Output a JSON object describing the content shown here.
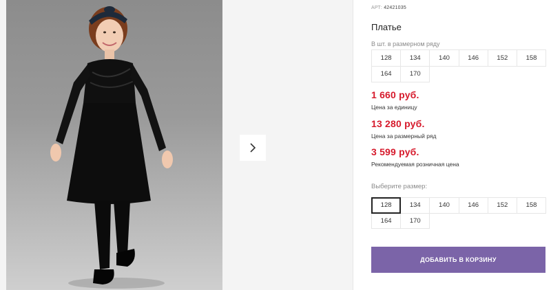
{
  "gallery": {
    "photo_alt": "Платье",
    "next_icon": "chevron-right-icon"
  },
  "product": {
    "art_label": "АРТ:",
    "art_value": "42421035",
    "title": "Платье",
    "row_label": "В шт. в размерном ряду",
    "row_sizes": [
      "128",
      "134",
      "140",
      "146",
      "152",
      "158",
      "164",
      "170"
    ],
    "price_unit": "1 660 руб.",
    "price_unit_caption": "Цена за единицу",
    "price_row": "13 280 руб.",
    "price_row_caption": "Цена за размерный ряд",
    "price_retail": "3 599 руб.",
    "price_retail_caption": "Рекомендуемая розничная цена",
    "choose_size_label": "Выберите размер:",
    "select_sizes": [
      "128",
      "134",
      "140",
      "146",
      "152",
      "158",
      "164",
      "170"
    ],
    "selected_size": "128",
    "add_to_cart": "ДОБАВИТЬ В КОРЗИНУ"
  },
  "colors": {
    "price": "#d6192b",
    "button": "#7b64a8"
  }
}
